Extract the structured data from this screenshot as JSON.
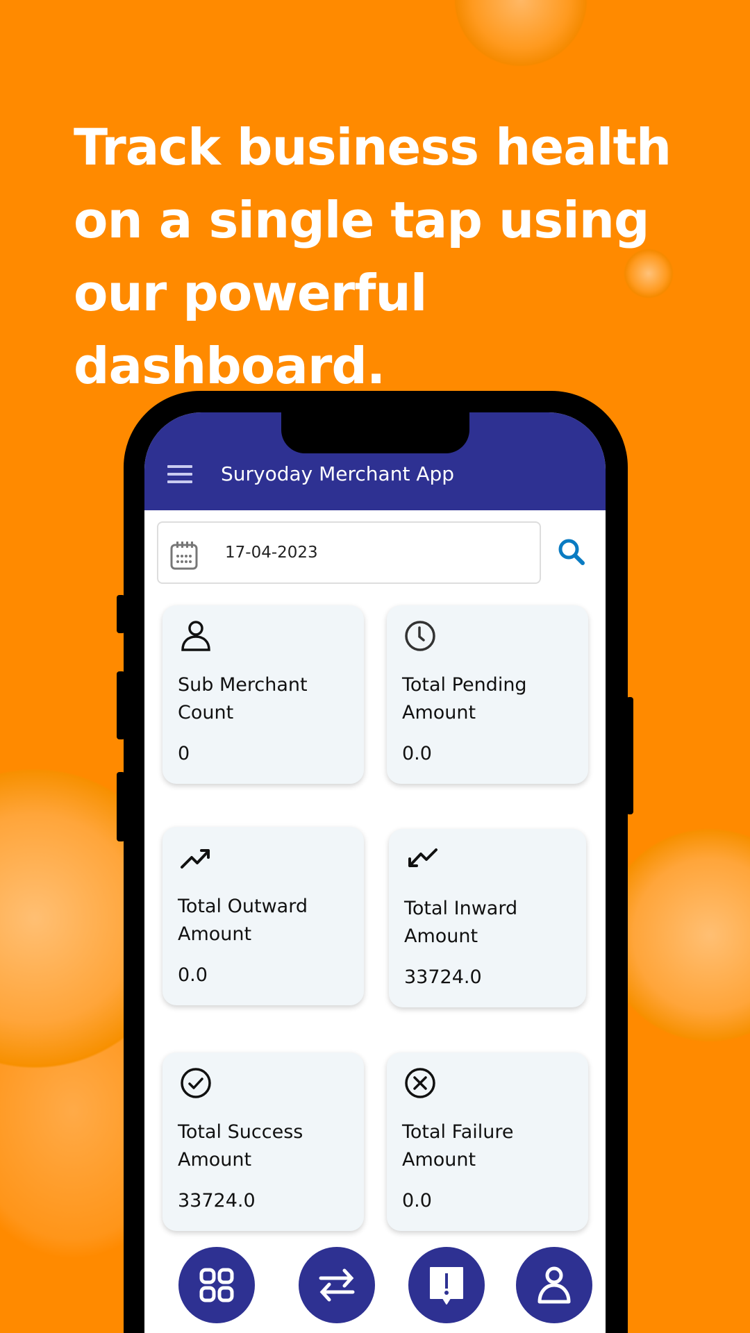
{
  "headline": "Track business health on a single tap using our powerful dashboard.",
  "colors": {
    "background": "#FF8A00",
    "app_bar": "#2E3192",
    "card": "#F1F6F9",
    "search": "#0A7BC2"
  },
  "app": {
    "title": "Suryoday Merchant App",
    "menu_icon": "hamburger-icon"
  },
  "date_filter": {
    "value": "17-04-2023",
    "icon": "calendar-icon",
    "search_icon": "search-icon"
  },
  "cards": [
    {
      "label": "Sub Merchant Count",
      "value": "0",
      "icon": "user-icon"
    },
    {
      "label": "Total Pending Amount",
      "value": "0.0",
      "icon": "clock-icon"
    },
    {
      "label": "Total Outward Amount",
      "value": "0.0",
      "icon": "trending-up-icon"
    },
    {
      "label": "Total Inward Amount",
      "value": "33724.0",
      "icon": "trending-down-icon"
    },
    {
      "label": "Total Success Amount",
      "value": "33724.0",
      "icon": "check-circle-icon"
    },
    {
      "label": "Total Failure Amount",
      "value": "0.0",
      "icon": "x-circle-icon"
    }
  ],
  "bottom_nav": [
    "dashboard-icon",
    "transfer-icon",
    "alert-icon",
    "profile-icon"
  ]
}
